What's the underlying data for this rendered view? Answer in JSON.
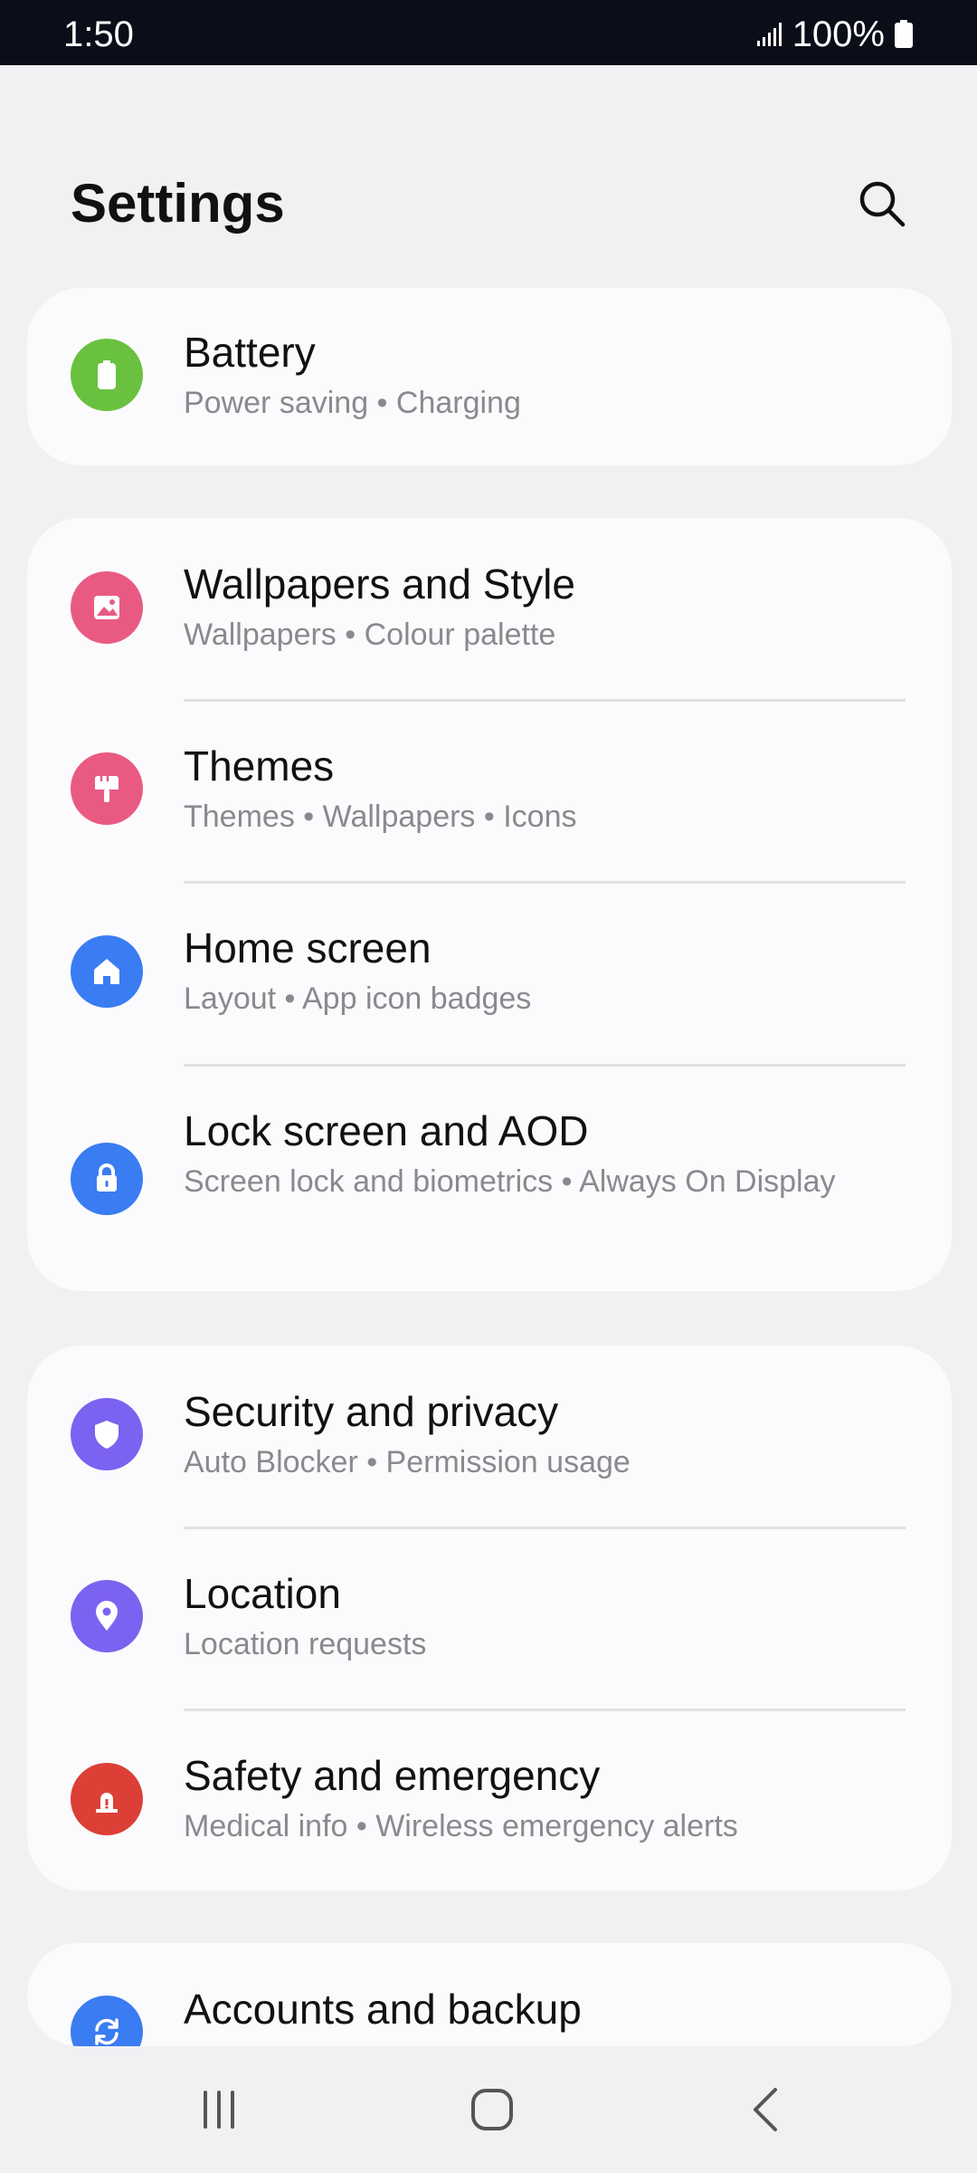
{
  "status_bar": {
    "time": "1:50",
    "battery_text": "100%",
    "icons": [
      "signal-icon",
      "battery-icon"
    ]
  },
  "header": {
    "title": "Settings",
    "search_icon": "search-icon"
  },
  "colors": {
    "battery": "#6ac13f",
    "wallpapers": "#e95a82",
    "themes": "#e95a82",
    "home_screen": "#3a7cf2",
    "lock_screen": "#3a7cf2",
    "security": "#7c62f0",
    "location": "#7c62f0",
    "safety": "#dc3f35",
    "accounts": "#3a7cf2"
  },
  "sections": [
    {
      "items": [
        {
          "id": "battery",
          "title": "Battery",
          "subtitle": "Power saving  •  Charging",
          "icon": "battery-icon"
        }
      ]
    },
    {
      "items": [
        {
          "id": "wallpapers",
          "title": "Wallpapers and Style",
          "subtitle": "Wallpapers  •  Colour palette",
          "icon": "image-icon"
        },
        {
          "id": "themes",
          "title": "Themes",
          "subtitle": "Themes  •  Wallpapers  •  Icons",
          "icon": "paint-brush-icon"
        },
        {
          "id": "home",
          "title": "Home screen",
          "subtitle": "Layout  •  App icon badges",
          "icon": "home-icon"
        },
        {
          "id": "lock",
          "title": "Lock screen and AOD",
          "subtitle": "Screen lock and biometrics  •  Always On Display",
          "icon": "lock-icon"
        }
      ]
    },
    {
      "items": [
        {
          "id": "security",
          "title": "Security and privacy",
          "subtitle": "Auto Blocker  •  Permission usage",
          "icon": "shield-icon"
        },
        {
          "id": "location",
          "title": "Location",
          "subtitle": "Location requests",
          "icon": "location-pin-icon"
        },
        {
          "id": "safety",
          "title": "Safety and emergency",
          "subtitle": "Medical info  •  Wireless emergency alerts",
          "icon": "emergency-icon"
        }
      ]
    },
    {
      "items": [
        {
          "id": "accounts",
          "title": "Accounts and backup",
          "icon": "sync-icon"
        }
      ]
    }
  ],
  "nav_bar": {
    "icons": [
      "recent-apps-icon",
      "home-icon",
      "back-icon"
    ]
  }
}
